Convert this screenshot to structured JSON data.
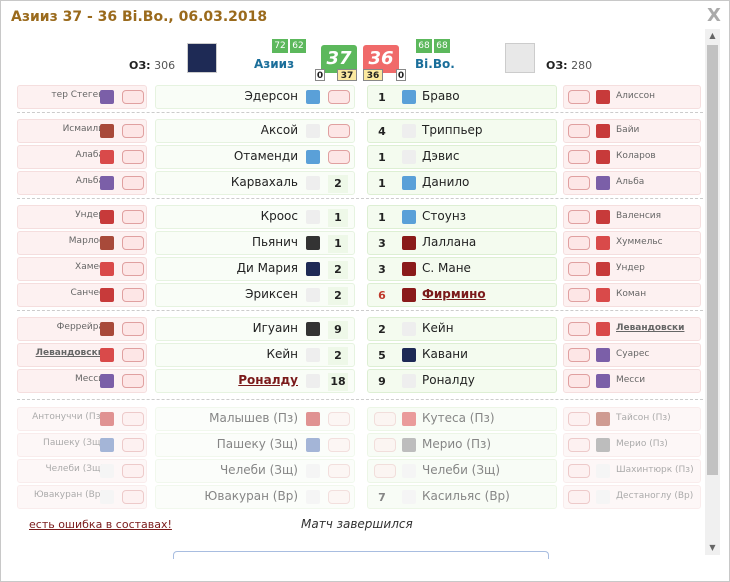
{
  "title": "Азииз 37 - 36 Bi.Bo., 06.03.2018",
  "close": "X",
  "home": {
    "oz_label": "ОЗ:",
    "oz_value": "306",
    "name": "Азииз",
    "pills": [
      "72",
      "62"
    ],
    "score": "37",
    "small_left": "0",
    "small_right": "37"
  },
  "away": {
    "oz_label": "ОЗ:",
    "oz_value": "280",
    "name": "Bi.Bo.",
    "pills": [
      "68",
      "68"
    ],
    "score": "36",
    "small_left": "36",
    "small_right": "0"
  },
  "colors": {
    "home_score": "#5cb85c",
    "away_score": "#f06a6a",
    "green": "#5cb85c"
  },
  "home_left_bench": [
    {
      "name": "тер Стеген",
      "shirt": "#7b5fa8"
    },
    {
      "name": "Исмаили",
      "shirt": "#a84a3a"
    },
    {
      "name": "Алаба",
      "shirt": "#d94a4a"
    },
    {
      "name": "Альба",
      "shirt": "#7b5fa8"
    },
    {
      "name": "Ундер",
      "shirt": "#c73a3a"
    },
    {
      "name": "Марлос",
      "shirt": "#a84a3a"
    },
    {
      "name": "Хамес",
      "shirt": "#d94a4a"
    },
    {
      "name": "Санчес",
      "shirt": "#c73a3a"
    },
    {
      "name": "Феррейра",
      "shirt": "#a84a3a"
    },
    {
      "name": "Левандовски",
      "shirt": "#d94a4a",
      "link": true
    },
    {
      "name": "Месси",
      "shirt": "#7b5fa8"
    },
    {
      "name": "Антонуччи (Пз)",
      "shirt": "#c73a3a"
    },
    {
      "name": "Пашеку (Зщ)",
      "shirt": "#5a7ab8"
    },
    {
      "name": "Челеби (Зщ)",
      "shirt": "#eeeeee"
    },
    {
      "name": "Ювакуран (Вр)",
      "shirt": "#eeeeee"
    }
  ],
  "home_lineup": [
    {
      "name": "Эдерсон",
      "shirt": "#5aa0d8",
      "val": "—"
    },
    {
      "name": "Аксой",
      "shirt": "#eeeeee",
      "val": "—"
    },
    {
      "name": "Отаменди",
      "shirt": "#5aa0d8",
      "val": "—"
    },
    {
      "name": "Карвахаль",
      "shirt": "#eeeeee",
      "val": "2"
    },
    {
      "name": "Кроос",
      "shirt": "#eeeeee",
      "val": "1"
    },
    {
      "name": "Пьянич",
      "shirt": "#333333",
      "val": "1"
    },
    {
      "name": "Ди Мария",
      "shirt": "#1e2a55",
      "val": "2"
    },
    {
      "name": "Эриксен",
      "shirt": "#eeeeee",
      "val": "2"
    },
    {
      "name": "Игуаин",
      "shirt": "#333333",
      "val": "9"
    },
    {
      "name": "Кейн",
      "shirt": "#eeeeee",
      "val": "2"
    },
    {
      "name": "Роналду",
      "shirt": "#eeeeee",
      "val": "18",
      "link": true
    },
    {
      "name": "Малышев (Пз)",
      "shirt": "#c73a3a",
      "val": ""
    },
    {
      "name": "Пашеку (Зщ)",
      "shirt": "#5a7ab8",
      "val": ""
    },
    {
      "name": "Челеби (Зщ)",
      "shirt": "#eeeeee",
      "val": ""
    },
    {
      "name": "Ювакуран (Вр)",
      "shirt": "#eeeeee",
      "val": ""
    }
  ],
  "away_lineup": [
    {
      "name": "Браво",
      "shirt": "#5aa0d8",
      "val": "1"
    },
    {
      "name": "Триппьер",
      "shirt": "#eeeeee",
      "val": "4"
    },
    {
      "name": "Дэвис",
      "shirt": "#eeeeee",
      "val": "1"
    },
    {
      "name": "Данило",
      "shirt": "#5aa0d8",
      "val": "1"
    },
    {
      "name": "Стоунз",
      "shirt": "#5aa0d8",
      "val": "1"
    },
    {
      "name": "Лаллана",
      "shirt": "#8a1a1a",
      "val": "3"
    },
    {
      "name": "С. Мане",
      "shirt": "#8a1a1a",
      "val": "3"
    },
    {
      "name": "Фирмино",
      "shirt": "#8a1a1a",
      "val": "6",
      "link": true
    },
    {
      "name": "Кейн",
      "shirt": "#eeeeee",
      "val": "2"
    },
    {
      "name": "Кавани",
      "shirt": "#1e2a55",
      "val": "5"
    },
    {
      "name": "Роналду",
      "shirt": "#eeeeee",
      "val": "9"
    },
    {
      "name": "Кутеса (Пз)",
      "shirt": "#d94a4a",
      "val": "—"
    },
    {
      "name": "Мерио (Пз)",
      "shirt": "#888888",
      "val": "—"
    },
    {
      "name": "Челеби (Зщ)",
      "shirt": "#eeeeee",
      "val": "—"
    },
    {
      "name": "Касильяс (Вр)",
      "shirt": "#eeeeee",
      "val": "7"
    }
  ],
  "away_right_bench": [
    {
      "name": "Алиссон",
      "shirt": "#c73a3a"
    },
    {
      "name": "Байи",
      "shirt": "#c73a3a"
    },
    {
      "name": "Коларов",
      "shirt": "#c73a3a"
    },
    {
      "name": "Альба",
      "shirt": "#7b5fa8"
    },
    {
      "name": "Валенсия",
      "shirt": "#c73a3a"
    },
    {
      "name": "Хуммельс",
      "shirt": "#d94a4a"
    },
    {
      "name": "Ундер",
      "shirt": "#c73a3a"
    },
    {
      "name": "Коман",
      "shirt": "#d94a4a"
    },
    {
      "name": "Левандовски",
      "shirt": "#d94a4a",
      "link": true
    },
    {
      "name": "Суарес",
      "shirt": "#7b5fa8"
    },
    {
      "name": "Месси",
      "shirt": "#7b5fa8"
    },
    {
      "name": "Тайсон (Пз)",
      "shirt": "#a84a3a"
    },
    {
      "name": "Мерио (Пз)",
      "shirt": "#888888"
    },
    {
      "name": "Шахинтюрк (Пз)",
      "shirt": "#eeeeee"
    },
    {
      "name": "Дестаноглу (Вр)",
      "shirt": "#eeeeee"
    }
  ],
  "footer": {
    "report_link": "есть ошибка в составах!",
    "status": "Матч завершился"
  }
}
